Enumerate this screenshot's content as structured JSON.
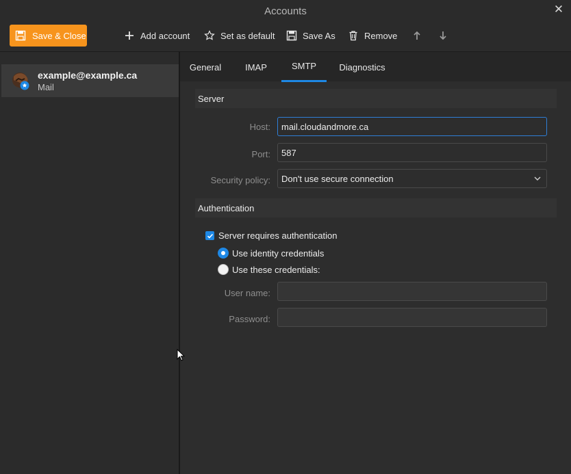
{
  "window": {
    "title": "Accounts",
    "close_glyph": "✕"
  },
  "toolbar": {
    "save_close": "Save & Close",
    "add_account": "Add account",
    "set_default": "Set as default",
    "save_as": "Save As",
    "remove": "Remove",
    "accent": "#f7941d"
  },
  "sidebar": {
    "accounts": [
      {
        "email": "example@example.ca",
        "type": "Mail"
      }
    ]
  },
  "tabs": [
    {
      "label": "General"
    },
    {
      "label": "IMAP"
    },
    {
      "label": "SMTP",
      "active": true
    },
    {
      "label": "Diagnostics"
    }
  ],
  "server": {
    "heading": "Server",
    "host_label": "Host:",
    "host_value": "mail.cloudandmore.ca",
    "port_label": "Port:",
    "port_value": "587",
    "security_label": "Security policy:",
    "security_value": "Don't use secure connection"
  },
  "auth": {
    "heading": "Authentication",
    "requires_auth": "Server requires authentication",
    "requires_auth_checked": true,
    "use_identity": "Use identity credentials",
    "use_identity_selected": true,
    "use_these": "Use these credentials:",
    "use_these_selected": false,
    "username_label": "User name:",
    "username_value": "",
    "password_label": "Password:",
    "password_value": ""
  },
  "colors": {
    "selection": "#1e88e5",
    "background": "#2b2b2b"
  }
}
